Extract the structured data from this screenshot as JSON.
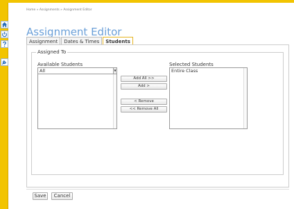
{
  "sidebar": {
    "buttons": [
      {
        "icon": "home-icon",
        "color": "#2a6ebb"
      },
      {
        "icon": "power-icon",
        "color": "#2a6ebb"
      },
      {
        "icon": "help-icon",
        "color": "#2a6ebb"
      },
      {
        "icon": "tools-icon",
        "color": "#2a6ebb"
      }
    ],
    "background": "#f2c400"
  },
  "breadcrumb": "Home » Assignments » Assignment Editor",
  "page": {
    "title": "Assignment Editor",
    "title_color": "#6a9fd8"
  },
  "tabs": [
    {
      "label": "Assignment"
    },
    {
      "label": "Dates & Times"
    },
    {
      "label": "Students",
      "active": true
    }
  ],
  "assigned_to": {
    "legend": "Assigned To",
    "available_label": "Available Students",
    "available_select_value": "All",
    "selected_label": "Selected Students",
    "selected_items": [
      "Entire Class"
    ]
  },
  "actions": {
    "add_all": "Add All >>",
    "add": "Add >",
    "remove": "< Remove",
    "remove_all": "<< Remove All"
  },
  "footer": {
    "save": "Save",
    "cancel": "Cancel"
  }
}
